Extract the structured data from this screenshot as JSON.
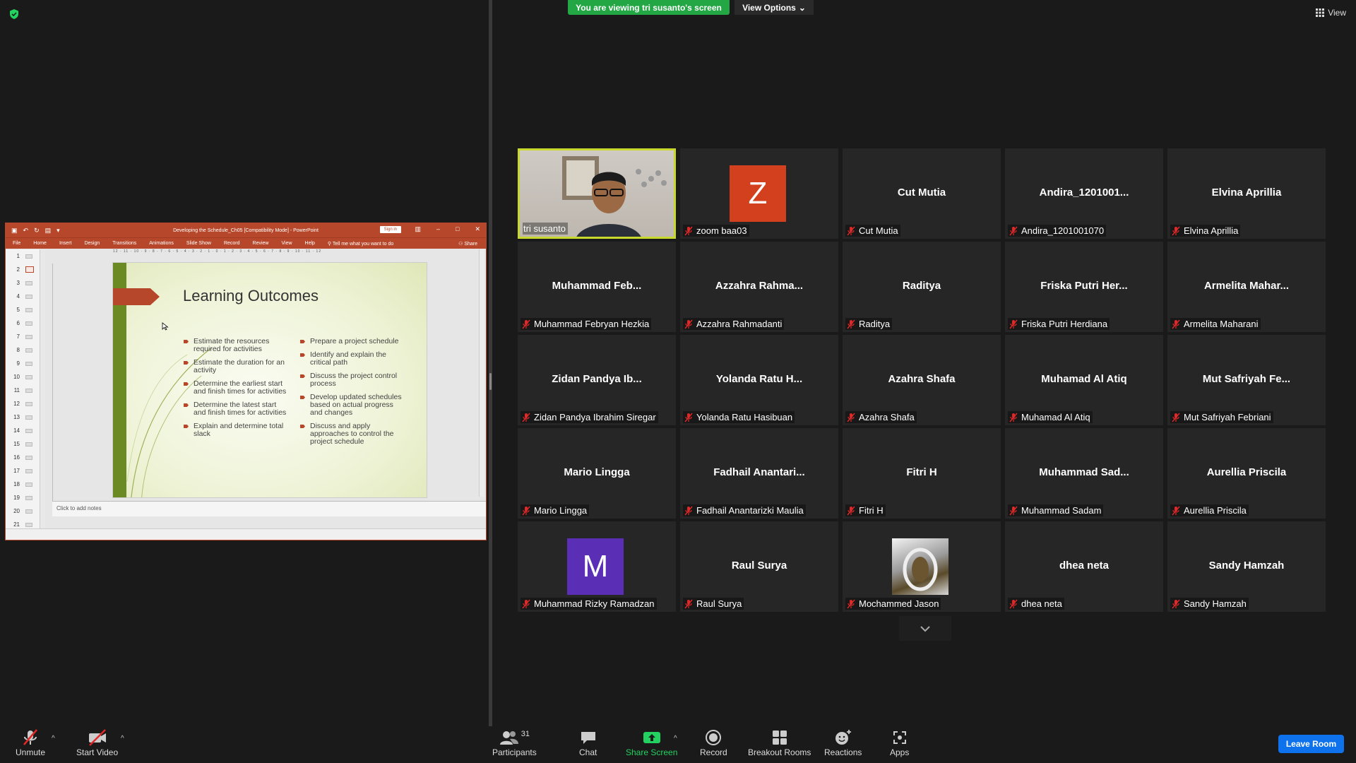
{
  "banner": {
    "viewing_text": "You are viewing tri susanto's screen",
    "view_options_label": "View Options",
    "view_label": "View"
  },
  "powerpoint": {
    "doc_title": "Developing the Schedule_Ch05 [Compatibility Mode] - PowerPoint",
    "sign_in": "Sign in",
    "menu": [
      "File",
      "Home",
      "Insert",
      "Design",
      "Transitions",
      "Animations",
      "Slide Show",
      "Record",
      "Review",
      "View",
      "Help",
      "Tell me what you want to do"
    ],
    "share": "Share",
    "slide_numbers": [
      "1",
      "2",
      "3",
      "4",
      "5",
      "6",
      "7",
      "8",
      "9",
      "10",
      "11",
      "12",
      "13",
      "14",
      "15",
      "16",
      "17",
      "18",
      "19",
      "20",
      "21"
    ],
    "ruler_text": "12 · 11 · 10 · 9 · 8 · 7 · 6 · 5 · 4 · 3 · 2 · 1 · 0 · 1 · 2 · 3 · 4 · 5 · 6 · 7 · 8 · 9 · 10 · 11 · 12",
    "slide_title": "Learning Outcomes",
    "bullets_left": [
      "Estimate the resources required for activities",
      "Estimate the duration for an activity",
      "Determine the earliest start and finish times for activities",
      "Determine the latest start and finish times for activities",
      "Explain and determine total slack"
    ],
    "bullets_right": [
      "Prepare a project schedule",
      "Identify and explain the critical path",
      "Discuss the project control process",
      "Develop updated schedules based on actual progress and changes",
      "Discuss and apply approaches to control the project schedule"
    ],
    "notes_placeholder": "Click to add notes"
  },
  "participants": [
    {
      "center": "",
      "label": "tri susanto",
      "type": "video",
      "muted": false
    },
    {
      "center": "Z",
      "label": "zoom baa03",
      "type": "avatar",
      "color": "#d2401d",
      "muted": true
    },
    {
      "center": "Cut Mutia",
      "label": "Cut Mutia",
      "type": "name",
      "muted": true
    },
    {
      "center": "Andira_1201001...",
      "label": "Andira_1201001070",
      "type": "name",
      "muted": true
    },
    {
      "center": "Elvina Aprillia",
      "label": "Elvina Aprillia",
      "type": "name",
      "muted": true
    },
    {
      "center": "Muhammad  Feb...",
      "label": "Muhammad Febryan Hezkia",
      "type": "name",
      "muted": true
    },
    {
      "center": "Azzahra  Rahma...",
      "label": "Azzahra Rahmadanti",
      "type": "name",
      "muted": true
    },
    {
      "center": "Raditya",
      "label": "Raditya",
      "type": "name",
      "muted": true
    },
    {
      "center": "Friska  Putri  Her...",
      "label": "Friska Putri Herdiana",
      "type": "name",
      "muted": true
    },
    {
      "center": "Armelita  Mahar...",
      "label": "Armelita Maharani",
      "type": "name",
      "muted": true
    },
    {
      "center": "Zidan  Pandya  Ib...",
      "label": "Zidan Pandya Ibrahim Siregar",
      "type": "name",
      "muted": true
    },
    {
      "center": "Yolanda  Ratu  H...",
      "label": "Yolanda Ratu Hasibuan",
      "type": "name",
      "muted": true
    },
    {
      "center": "Azahra Shafa",
      "label": "Azahra Shafa",
      "type": "name",
      "muted": true
    },
    {
      "center": "Muhamad Al Atiq",
      "label": "Muhamad Al Atiq",
      "type": "name",
      "muted": true
    },
    {
      "center": "Mut  Safriyah  Fe...",
      "label": "Mut Safriyah Febriani",
      "type": "name",
      "muted": true
    },
    {
      "center": "Mario Lingga",
      "label": "Mario Lingga",
      "type": "name",
      "muted": true
    },
    {
      "center": "Fadhail  Anantari...",
      "label": "Fadhail Anantarizki Maulia",
      "type": "name",
      "muted": true
    },
    {
      "center": "Fitri H",
      "label": "Fitri H",
      "type": "name",
      "muted": true
    },
    {
      "center": "Muhammad  Sad...",
      "label": "Muhammad Sadam",
      "type": "name",
      "muted": true
    },
    {
      "center": "Aurellia Priscila",
      "label": "Aurellia Priscila",
      "type": "name",
      "muted": true
    },
    {
      "center": "M",
      "label": "Muhammad Rizky Ramadzan",
      "type": "avatar",
      "color": "#5b2fb5",
      "muted": true
    },
    {
      "center": "Raul Surya",
      "label": "Raul Surya",
      "type": "name",
      "muted": true
    },
    {
      "center": "",
      "label": "Mochammed Jason",
      "type": "photo",
      "muted": true
    },
    {
      "center": "dhea neta",
      "label": "dhea neta",
      "type": "name",
      "muted": true
    },
    {
      "center": "Sandy Hamzah",
      "label": "Sandy Hamzah",
      "type": "name",
      "muted": true
    }
  ],
  "toolbar": {
    "unmute": "Unmute",
    "start_video": "Start Video",
    "participants": "Participants",
    "participant_count": "31",
    "chat": "Chat",
    "share_screen": "Share Screen",
    "record": "Record",
    "breakout_rooms": "Breakout Rooms",
    "reactions": "Reactions",
    "apps": "Apps",
    "leave_room": "Leave Room"
  },
  "colors": {
    "zoom_green": "#23a744",
    "ppt_red": "#b7472a",
    "leave_blue": "#0e72ed",
    "active_speaker": "#c9d82d"
  }
}
